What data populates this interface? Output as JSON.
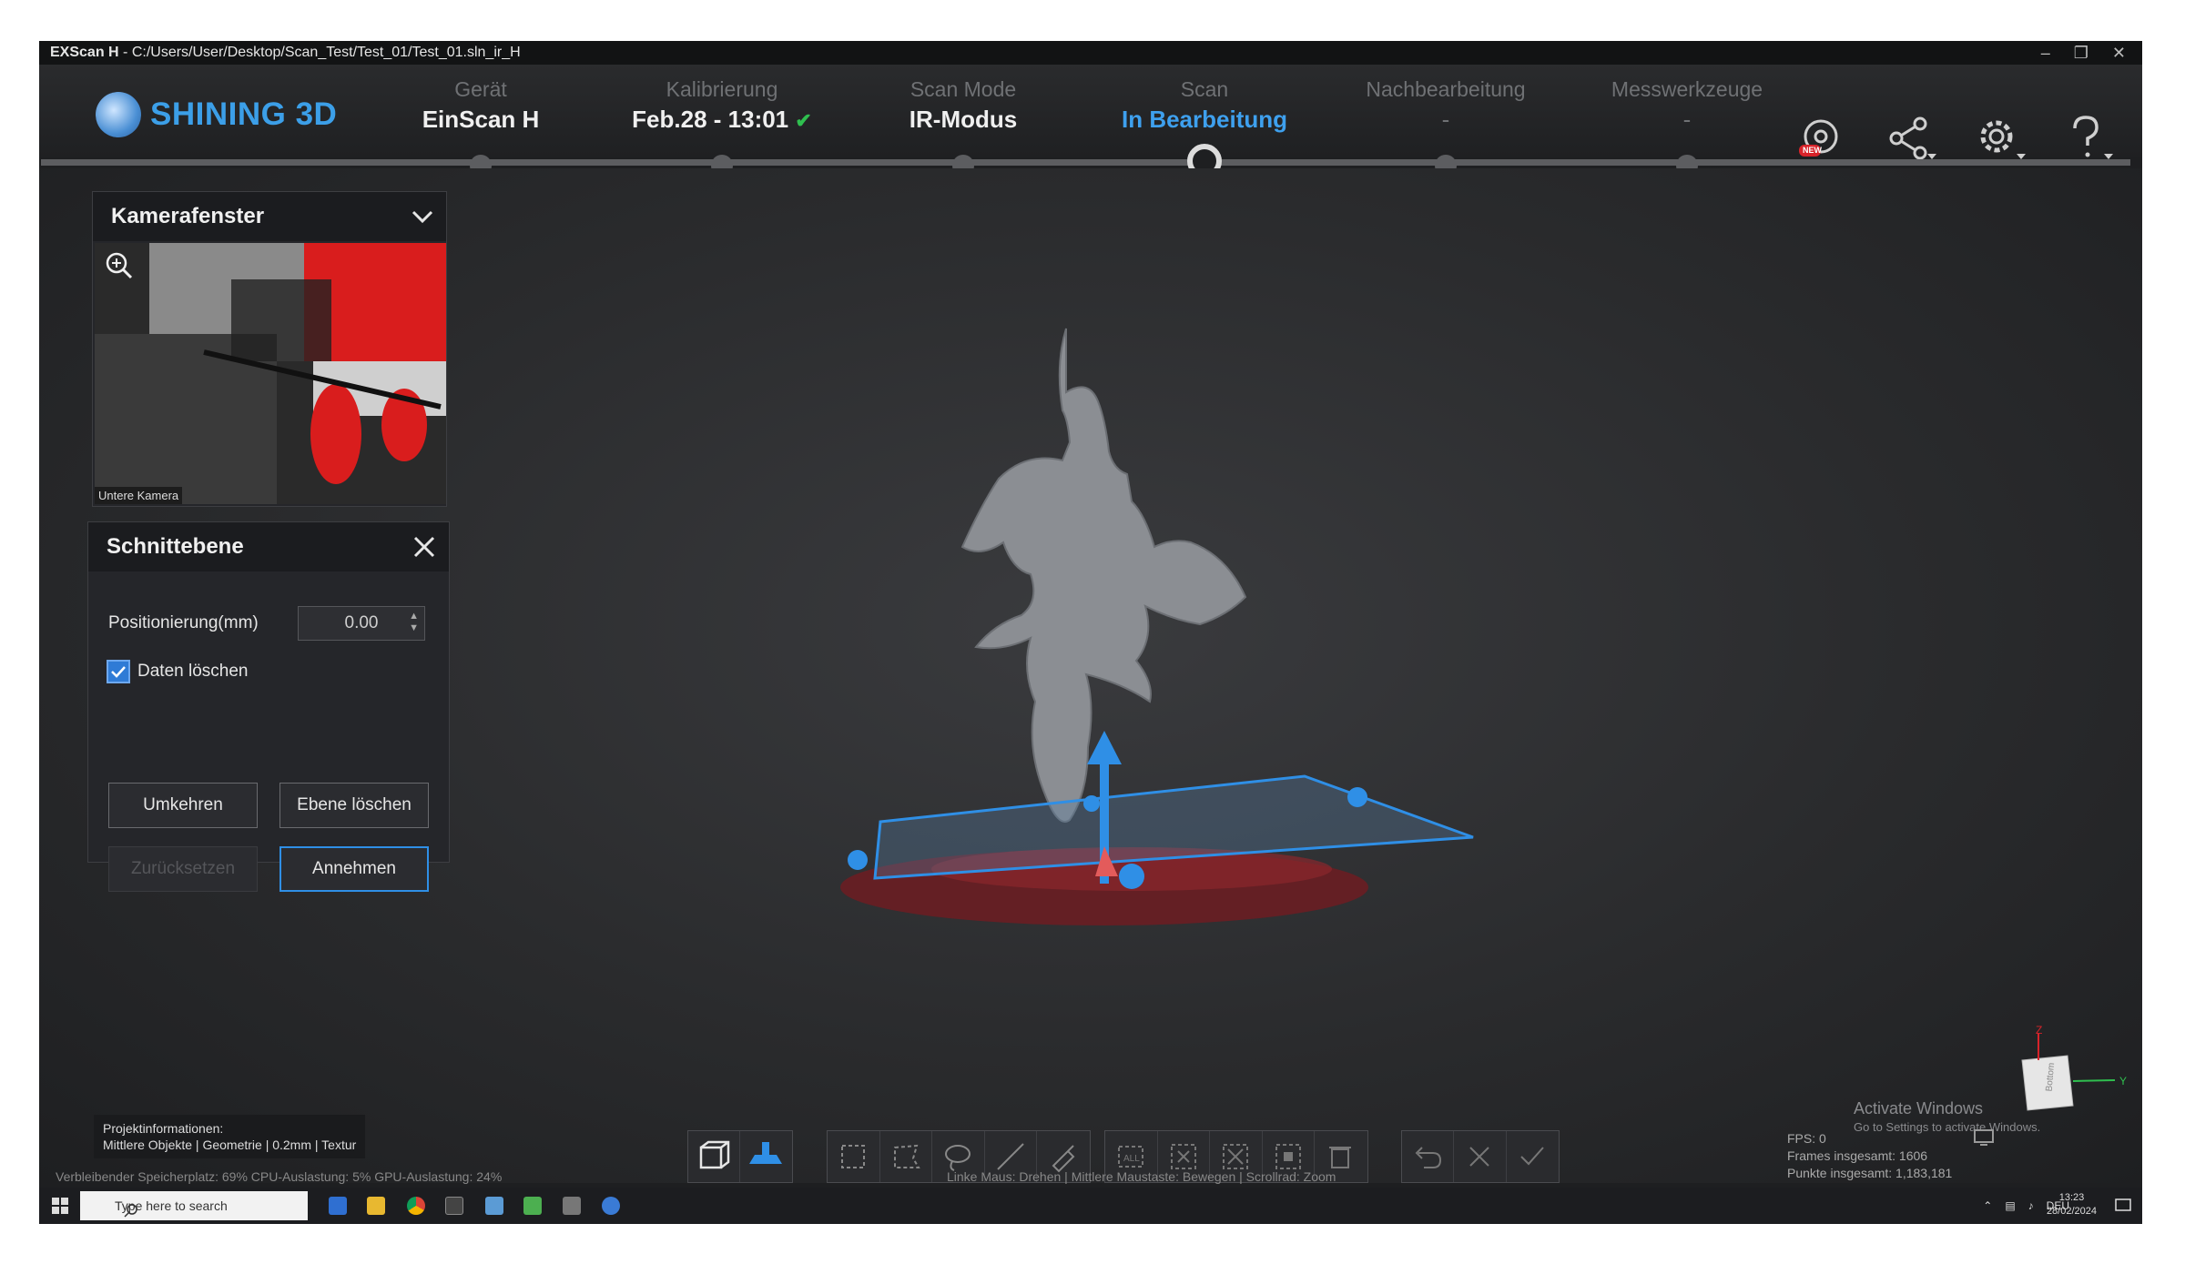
{
  "titlebar": {
    "app": "EXScan H",
    "path": " -  C:/Users/User/Desktop/Scan_Test/Test_01/Test_01.sln_ir_H"
  },
  "logo": {
    "text": "SHINING 3D"
  },
  "steps": [
    {
      "label": "Gerät",
      "value": "EinScan H"
    },
    {
      "label": "Kalibrierung",
      "value": "Feb.28 - 13:01"
    },
    {
      "label": "Scan Mode",
      "value": "IR-Modus"
    },
    {
      "label": "Scan",
      "value": "In Bearbeitung"
    },
    {
      "label": "Nachbearbeitung",
      "value": "-"
    },
    {
      "label": "Messwerkzeuge",
      "value": "-"
    }
  ],
  "camera_panel": {
    "title": "Kamerafenster",
    "label": "Untere Kamera"
  },
  "cut_panel": {
    "title": "Schnittebene",
    "position_label": "Positionierung(mm)",
    "position_value": "0.00",
    "delete_label": "Daten löschen",
    "buttons": {
      "invert": "Umkehren",
      "delete_plane": "Ebene löschen",
      "reset": "Zurücksetzen",
      "accept": "Annehmen"
    }
  },
  "project_info": {
    "title": "Projektinformationen:",
    "details": "Mittlere Objekte | Geometrie | 0.2mm | Textur"
  },
  "status": {
    "resources": "Verbleibender Speicherplatz: 69%  CPU-Auslastung: 5%  GPU-Auslastung: 24%",
    "mouse_hint": "Linke Maus: Drehen | Mittlere Maustaste: Bewegen | Scrollrad: Zoom"
  },
  "stats": {
    "fps": "FPS: 0",
    "frames": "Frames insgesamt: 1606",
    "points": "Punkte insgesamt: 1,183,181"
  },
  "activate": {
    "line1": "Activate Windows",
    "line2": "Go to Settings to activate Windows."
  },
  "axis": {
    "z": "Z",
    "y": "Y",
    "cube_label": "Bottom"
  },
  "badges": {
    "new": "NEW"
  },
  "taskbar": {
    "search_placeholder": "Type here to search",
    "lang": "DEU",
    "time": "13:23",
    "date": "28/02/2024"
  }
}
